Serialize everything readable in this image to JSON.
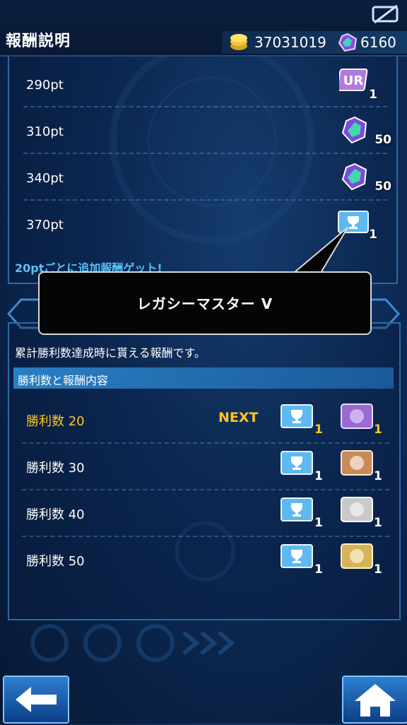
{
  "header": {
    "title": "報酬説明",
    "coins": "37031019",
    "gems": "6160"
  },
  "upper": {
    "rows": [
      {
        "pt": "290pt",
        "reward_icon": "ur-card-icon",
        "count": "1"
      },
      {
        "pt": "310pt",
        "reward_icon": "gem-icon",
        "count": "50"
      },
      {
        "pt": "340pt",
        "reward_icon": "gem-icon",
        "count": "50"
      },
      {
        "pt": "370pt",
        "reward_icon": "trophy-ticket-icon",
        "count": "1"
      }
    ],
    "footer_note": "20ptごとに追加報酬ゲット!"
  },
  "tooltip": {
    "text": "レガシーマスター Ⅴ"
  },
  "lower": {
    "description": "累計勝利数達成時に貰える報酬です。",
    "section_title": "勝利数と報酬内容",
    "next_label": "NEXT",
    "rows": [
      {
        "label": "勝利数 20",
        "ticket_count": "1",
        "card_count": "1",
        "card_color": "#9a6ad0"
      },
      {
        "label": "勝利数 30",
        "ticket_count": "1",
        "card_count": "1",
        "card_color": "#c98a5a"
      },
      {
        "label": "勝利数 40",
        "ticket_count": "1",
        "card_count": "1",
        "card_color": "#c9c9c9"
      },
      {
        "label": "勝利数 50",
        "ticket_count": "1",
        "card_count": "1",
        "card_color": "#d6b35a"
      }
    ]
  },
  "colors": {
    "accent_yellow": "#ffc51c",
    "note_blue": "#59bff5"
  }
}
